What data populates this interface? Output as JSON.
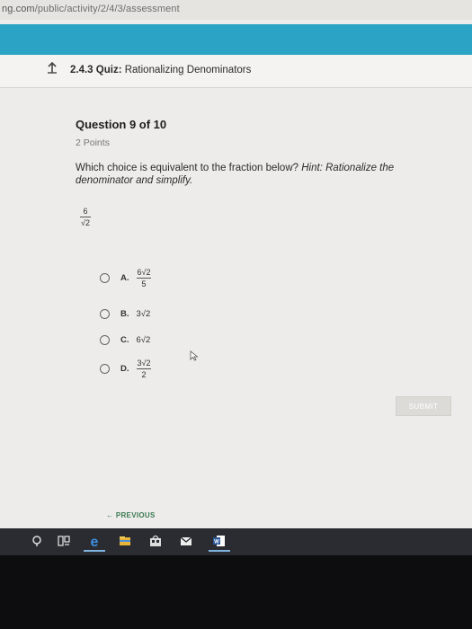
{
  "browser": {
    "url_prefix": "ng.com",
    "url_path": "/public/activity/2/4/3/assessment"
  },
  "header": {
    "quiz_number": "2.4.3",
    "quiz_label": "Quiz:",
    "quiz_name": "Rationalizing Denominators"
  },
  "question": {
    "title": "Question 9 of 10",
    "points": "2 Points",
    "text_main": "Which choice is equivalent to the fraction below? ",
    "text_hint": "Hint: Rationalize the denominator and simplify.",
    "fraction": {
      "numerator": "6",
      "denominator": "√2"
    }
  },
  "options": [
    {
      "letter": "A.",
      "numerator": "6√2",
      "denominator": "5"
    },
    {
      "letter": "B.",
      "value": "3√2"
    },
    {
      "letter": "C.",
      "value": "6√2"
    },
    {
      "letter": "D.",
      "numerator": "3√2",
      "denominator": "2"
    }
  ],
  "actions": {
    "submit_label": "SUBMIT",
    "previous_label": "PREVIOUS"
  },
  "colors": {
    "banner": "#2aa3c4",
    "background": "#eeecea",
    "previous_link": "#3a7a52",
    "taskbar": "#2a2c31"
  },
  "taskbar_icons": [
    "search-icon",
    "task-view-icon",
    "edge-icon",
    "file-explorer-icon",
    "store-icon",
    "mail-icon",
    "word-icon"
  ]
}
